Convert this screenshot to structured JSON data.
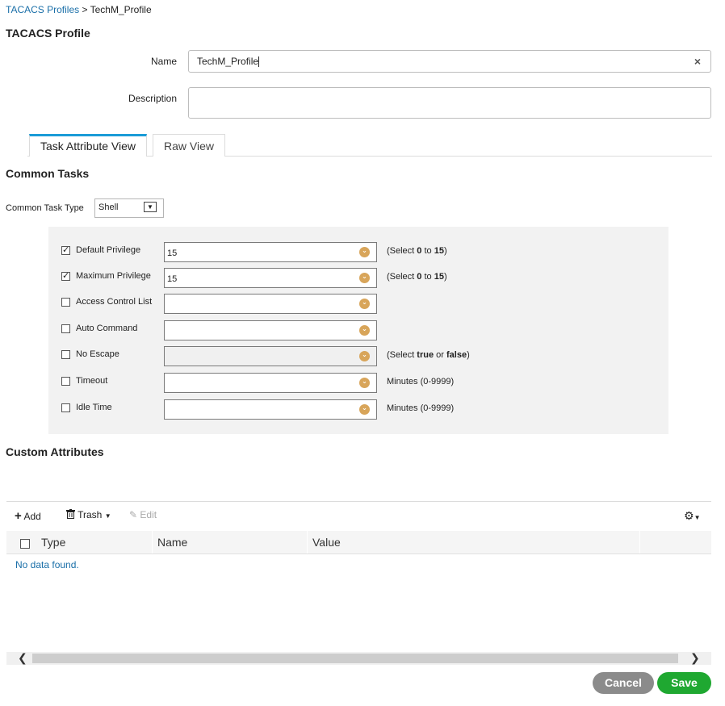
{
  "breadcrumb": {
    "parent": "TACACS Profiles",
    "separator": " > ",
    "current": "TechM_Profile"
  },
  "page_title": "TACACS Profile",
  "form": {
    "name_label": "Name",
    "name_value": "TechM_Profile",
    "clear_glyph": "×",
    "description_label": "Description",
    "description_value": ""
  },
  "tabs": [
    {
      "label": "Task Attribute View",
      "active": true
    },
    {
      "label": "Raw View",
      "active": false
    }
  ],
  "common_tasks": {
    "title": "Common Tasks",
    "type_label": "Common Task Type",
    "type_value": "Shell",
    "rows": [
      {
        "label": "Default Privilege",
        "checked": true,
        "value": "15",
        "hint_pre": "(Select ",
        "hint_b1": "0",
        "hint_mid": " to ",
        "hint_b2": "15",
        "hint_post": ")",
        "disabled": false
      },
      {
        "label": "Maximum Privilege",
        "checked": true,
        "value": "15",
        "hint_pre": "(Select ",
        "hint_b1": "0",
        "hint_mid": " to ",
        "hint_b2": "15",
        "hint_post": ")",
        "disabled": false
      },
      {
        "label": "Access Control List",
        "checked": false,
        "value": "",
        "hint_pre": "",
        "hint_b1": "",
        "hint_mid": "",
        "hint_b2": "",
        "hint_post": "",
        "disabled": false
      },
      {
        "label": "Auto Command",
        "checked": false,
        "value": "",
        "hint_pre": "",
        "hint_b1": "",
        "hint_mid": "",
        "hint_b2": "",
        "hint_post": "",
        "disabled": false
      },
      {
        "label": "No Escape",
        "checked": false,
        "value": "",
        "hint_pre": "(Select ",
        "hint_b1": "true",
        "hint_mid": " or ",
        "hint_b2": "false",
        "hint_post": ")",
        "disabled": true
      },
      {
        "label": "Timeout",
        "checked": false,
        "value": "",
        "hint_pre": "Minutes (0-9999)",
        "hint_b1": "",
        "hint_mid": "",
        "hint_b2": "",
        "hint_post": "",
        "disabled": false
      },
      {
        "label": "Idle Time",
        "checked": false,
        "value": "",
        "hint_pre": "Minutes (0-9999)",
        "hint_b1": "",
        "hint_mid": "",
        "hint_b2": "",
        "hint_post": "",
        "disabled": false
      }
    ]
  },
  "custom_attributes": {
    "title": "Custom Attributes",
    "toolbar": {
      "add_label": "Add",
      "trash_label": "Trash",
      "edit_label": "Edit"
    },
    "columns": [
      "Type",
      "Name",
      "Value"
    ],
    "empty_text": "No data found."
  },
  "buttons": {
    "cancel_label": "Cancel",
    "save_label": "Save"
  },
  "colors": {
    "link": "#1a6fa8",
    "tab_accent": "#1a9bd7",
    "save": "#1fa831",
    "cancel": "#8b8b8b",
    "dropdown_icon": "#d8a55a"
  }
}
